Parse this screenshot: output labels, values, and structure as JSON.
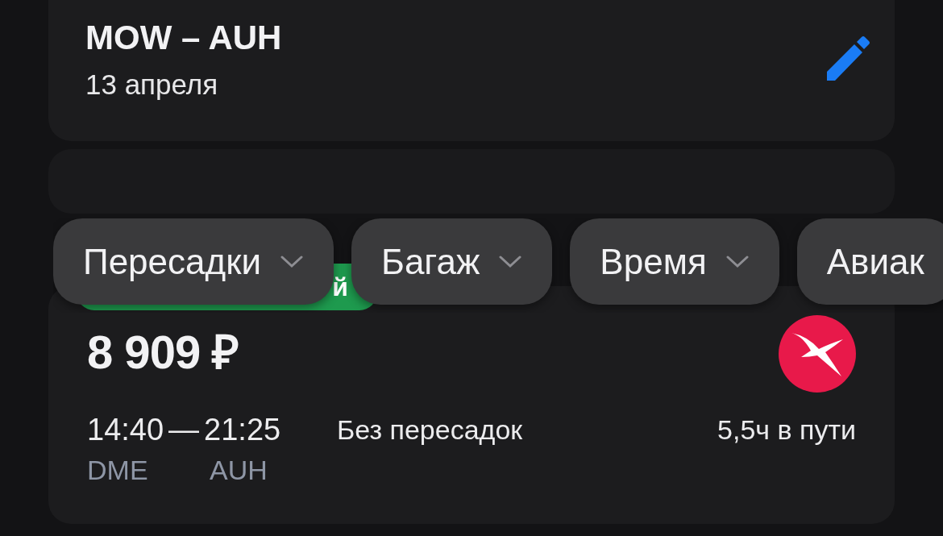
{
  "route": {
    "title": "MOW – AUH",
    "date": "13 апреля"
  },
  "filters": [
    {
      "label": "Пересадки",
      "kind": "dropdown"
    },
    {
      "label": "Багаж",
      "kind": "dropdown"
    },
    {
      "label": "Время",
      "kind": "dropdown"
    },
    {
      "label": "Авиак",
      "kind": "partial"
    }
  ],
  "ticket": {
    "badge": "й",
    "price": "8 909 ₽",
    "depart_time": "14:40",
    "dash": "—",
    "arrive_time": "21:25",
    "depart_airport": "DME",
    "arrive_airport": "AUH",
    "stops": "Без пересадок",
    "duration": "5,5ч в пути"
  }
}
